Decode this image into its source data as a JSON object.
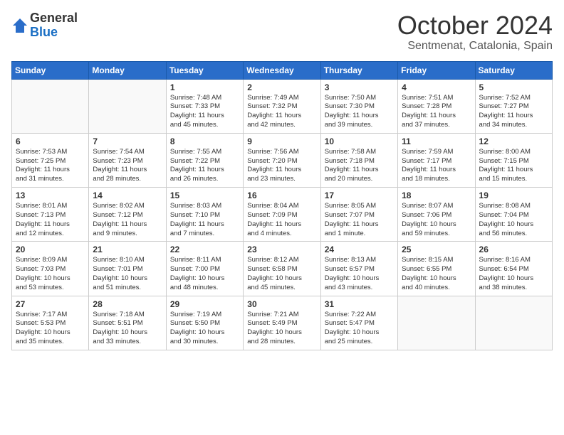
{
  "header": {
    "logo_general": "General",
    "logo_blue": "Blue",
    "month": "October 2024",
    "location": "Sentmenat, Catalonia, Spain"
  },
  "calendar": {
    "days_of_week": [
      "Sunday",
      "Monday",
      "Tuesday",
      "Wednesday",
      "Thursday",
      "Friday",
      "Saturday"
    ],
    "weeks": [
      [
        {
          "day": "",
          "detail": ""
        },
        {
          "day": "",
          "detail": ""
        },
        {
          "day": "1",
          "detail": "Sunrise: 7:48 AM\nSunset: 7:33 PM\nDaylight: 11 hours\nand 45 minutes."
        },
        {
          "day": "2",
          "detail": "Sunrise: 7:49 AM\nSunset: 7:32 PM\nDaylight: 11 hours\nand 42 minutes."
        },
        {
          "day": "3",
          "detail": "Sunrise: 7:50 AM\nSunset: 7:30 PM\nDaylight: 11 hours\nand 39 minutes."
        },
        {
          "day": "4",
          "detail": "Sunrise: 7:51 AM\nSunset: 7:28 PM\nDaylight: 11 hours\nand 37 minutes."
        },
        {
          "day": "5",
          "detail": "Sunrise: 7:52 AM\nSunset: 7:27 PM\nDaylight: 11 hours\nand 34 minutes."
        }
      ],
      [
        {
          "day": "6",
          "detail": "Sunrise: 7:53 AM\nSunset: 7:25 PM\nDaylight: 11 hours\nand 31 minutes."
        },
        {
          "day": "7",
          "detail": "Sunrise: 7:54 AM\nSunset: 7:23 PM\nDaylight: 11 hours\nand 28 minutes."
        },
        {
          "day": "8",
          "detail": "Sunrise: 7:55 AM\nSunset: 7:22 PM\nDaylight: 11 hours\nand 26 minutes."
        },
        {
          "day": "9",
          "detail": "Sunrise: 7:56 AM\nSunset: 7:20 PM\nDaylight: 11 hours\nand 23 minutes."
        },
        {
          "day": "10",
          "detail": "Sunrise: 7:58 AM\nSunset: 7:18 PM\nDaylight: 11 hours\nand 20 minutes."
        },
        {
          "day": "11",
          "detail": "Sunrise: 7:59 AM\nSunset: 7:17 PM\nDaylight: 11 hours\nand 18 minutes."
        },
        {
          "day": "12",
          "detail": "Sunrise: 8:00 AM\nSunset: 7:15 PM\nDaylight: 11 hours\nand 15 minutes."
        }
      ],
      [
        {
          "day": "13",
          "detail": "Sunrise: 8:01 AM\nSunset: 7:13 PM\nDaylight: 11 hours\nand 12 minutes."
        },
        {
          "day": "14",
          "detail": "Sunrise: 8:02 AM\nSunset: 7:12 PM\nDaylight: 11 hours\nand 9 minutes."
        },
        {
          "day": "15",
          "detail": "Sunrise: 8:03 AM\nSunset: 7:10 PM\nDaylight: 11 hours\nand 7 minutes."
        },
        {
          "day": "16",
          "detail": "Sunrise: 8:04 AM\nSunset: 7:09 PM\nDaylight: 11 hours\nand 4 minutes."
        },
        {
          "day": "17",
          "detail": "Sunrise: 8:05 AM\nSunset: 7:07 PM\nDaylight: 11 hours\nand 1 minute."
        },
        {
          "day": "18",
          "detail": "Sunrise: 8:07 AM\nSunset: 7:06 PM\nDaylight: 10 hours\nand 59 minutes."
        },
        {
          "day": "19",
          "detail": "Sunrise: 8:08 AM\nSunset: 7:04 PM\nDaylight: 10 hours\nand 56 minutes."
        }
      ],
      [
        {
          "day": "20",
          "detail": "Sunrise: 8:09 AM\nSunset: 7:03 PM\nDaylight: 10 hours\nand 53 minutes."
        },
        {
          "day": "21",
          "detail": "Sunrise: 8:10 AM\nSunset: 7:01 PM\nDaylight: 10 hours\nand 51 minutes."
        },
        {
          "day": "22",
          "detail": "Sunrise: 8:11 AM\nSunset: 7:00 PM\nDaylight: 10 hours\nand 48 minutes."
        },
        {
          "day": "23",
          "detail": "Sunrise: 8:12 AM\nSunset: 6:58 PM\nDaylight: 10 hours\nand 45 minutes."
        },
        {
          "day": "24",
          "detail": "Sunrise: 8:13 AM\nSunset: 6:57 PM\nDaylight: 10 hours\nand 43 minutes."
        },
        {
          "day": "25",
          "detail": "Sunrise: 8:15 AM\nSunset: 6:55 PM\nDaylight: 10 hours\nand 40 minutes."
        },
        {
          "day": "26",
          "detail": "Sunrise: 8:16 AM\nSunset: 6:54 PM\nDaylight: 10 hours\nand 38 minutes."
        }
      ],
      [
        {
          "day": "27",
          "detail": "Sunrise: 7:17 AM\nSunset: 5:53 PM\nDaylight: 10 hours\nand 35 minutes."
        },
        {
          "day": "28",
          "detail": "Sunrise: 7:18 AM\nSunset: 5:51 PM\nDaylight: 10 hours\nand 33 minutes."
        },
        {
          "day": "29",
          "detail": "Sunrise: 7:19 AM\nSunset: 5:50 PM\nDaylight: 10 hours\nand 30 minutes."
        },
        {
          "day": "30",
          "detail": "Sunrise: 7:21 AM\nSunset: 5:49 PM\nDaylight: 10 hours\nand 28 minutes."
        },
        {
          "day": "31",
          "detail": "Sunrise: 7:22 AM\nSunset: 5:47 PM\nDaylight: 10 hours\nand 25 minutes."
        },
        {
          "day": "",
          "detail": ""
        },
        {
          "day": "",
          "detail": ""
        }
      ]
    ]
  }
}
